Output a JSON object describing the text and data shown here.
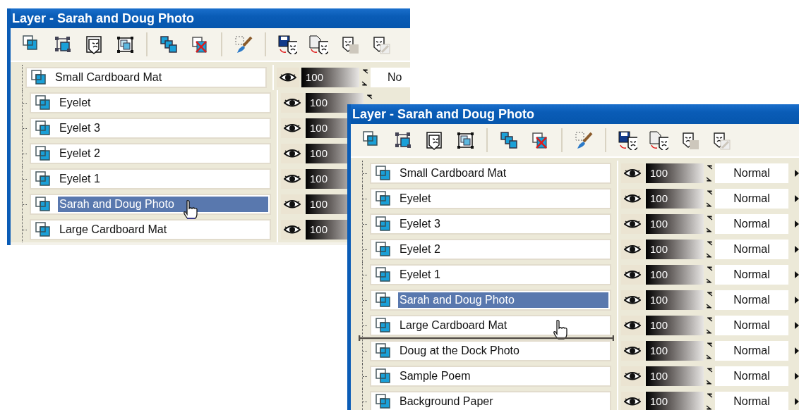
{
  "windows": [
    {
      "title": "Layer - Sarah and Doug Photo",
      "toolbar": [
        {
          "kind": "layers",
          "disabled": false
        },
        {
          "kind": "group",
          "disabled": false
        },
        {
          "kind": "mask",
          "disabled": false
        },
        {
          "kind": "frame",
          "disabled": false
        },
        {
          "kind": "separator"
        },
        {
          "kind": "duplicate",
          "disabled": false
        },
        {
          "kind": "delete",
          "disabled": false
        },
        {
          "kind": "separator"
        },
        {
          "kind": "brush",
          "disabled": false
        },
        {
          "kind": "separator"
        },
        {
          "kind": "save-mask",
          "disabled": false
        },
        {
          "kind": "load-mask",
          "disabled": false
        },
        {
          "kind": "mask-square",
          "disabled": true
        },
        {
          "kind": "mask-edit",
          "disabled": true
        }
      ],
      "layers": [
        {
          "name": "Small Cardboard Mat",
          "selected": false,
          "visible": true,
          "opacity": "100",
          "level": 1,
          "blend": "No",
          "pointer": false,
          "drop_line": false
        },
        {
          "name": "Eyelet",
          "selected": false,
          "visible": true,
          "opacity": "100",
          "level": 1,
          "pointer": false,
          "drop_line": false
        },
        {
          "name": "Eyelet 3",
          "selected": false,
          "visible": true,
          "opacity": "100",
          "level": 1,
          "pointer": false,
          "drop_line": false
        },
        {
          "name": "Eyelet 2",
          "selected": false,
          "visible": true,
          "opacity": "100",
          "level": 1,
          "pointer": false,
          "drop_line": false
        },
        {
          "name": "Eyelet 1",
          "selected": false,
          "visible": true,
          "opacity": "100",
          "level": 1,
          "pointer": false,
          "drop_line": false
        },
        {
          "name": "Sarah and Doug Photo",
          "selected": true,
          "visible": true,
          "opacity": "100",
          "level": 1,
          "pointer": true,
          "drop_line": false
        },
        {
          "name": "Large Cardboard Mat",
          "selected": false,
          "visible": true,
          "opacity": "100",
          "level": 1,
          "pointer": false,
          "drop_line": false
        }
      ]
    },
    {
      "title": "Layer - Sarah and Doug Photo",
      "toolbar": [
        {
          "kind": "layers",
          "disabled": false
        },
        {
          "kind": "group",
          "disabled": false
        },
        {
          "kind": "mask",
          "disabled": false
        },
        {
          "kind": "frame",
          "disabled": false
        },
        {
          "kind": "separator"
        },
        {
          "kind": "duplicate",
          "disabled": false
        },
        {
          "kind": "delete",
          "disabled": false
        },
        {
          "kind": "separator"
        },
        {
          "kind": "brush",
          "disabled": false
        },
        {
          "kind": "separator"
        },
        {
          "kind": "save-mask",
          "disabled": false
        },
        {
          "kind": "load-mask",
          "disabled": false
        },
        {
          "kind": "mask-square",
          "disabled": true
        },
        {
          "kind": "mask-edit",
          "disabled": true
        }
      ],
      "layers": [
        {
          "name": "Small Cardboard Mat",
          "selected": false,
          "visible": true,
          "opacity": "100",
          "level": 1,
          "blend": "Normal",
          "pointer": false,
          "drop_line": false
        },
        {
          "name": "Eyelet",
          "selected": false,
          "visible": true,
          "opacity": "100",
          "level": 1,
          "blend": "Normal",
          "pointer": false,
          "drop_line": false
        },
        {
          "name": "Eyelet 3",
          "selected": false,
          "visible": true,
          "opacity": "100",
          "level": 1,
          "blend": "Normal",
          "pointer": false,
          "drop_line": false
        },
        {
          "name": "Eyelet 2",
          "selected": false,
          "visible": true,
          "opacity": "100",
          "level": 1,
          "blend": "Normal",
          "pointer": false,
          "drop_line": false
        },
        {
          "name": "Eyelet 1",
          "selected": false,
          "visible": true,
          "opacity": "100",
          "level": 1,
          "blend": "Normal",
          "pointer": false,
          "drop_line": false
        },
        {
          "name": "Sarah and Doug Photo",
          "selected": true,
          "visible": true,
          "opacity": "100",
          "level": 1,
          "blend": "Normal",
          "pointer": false,
          "drop_line": false
        },
        {
          "name": "Large Cardboard Mat",
          "selected": false,
          "visible": true,
          "opacity": "100",
          "level": 1,
          "blend": "Normal",
          "pointer": true,
          "drop_line": true
        },
        {
          "name": "Doug at the Dock Photo",
          "selected": false,
          "visible": true,
          "opacity": "100",
          "level": 1,
          "blend": "Normal",
          "pointer": false,
          "drop_line": false
        },
        {
          "name": "Sample Poem",
          "selected": false,
          "visible": true,
          "opacity": "100",
          "level": 1,
          "blend": "Normal",
          "pointer": false,
          "drop_line": false
        },
        {
          "name": "Background Paper",
          "selected": false,
          "visible": true,
          "opacity": "100",
          "level": 1,
          "blend": "Normal",
          "pointer": false,
          "drop_line": false
        }
      ]
    }
  ]
}
